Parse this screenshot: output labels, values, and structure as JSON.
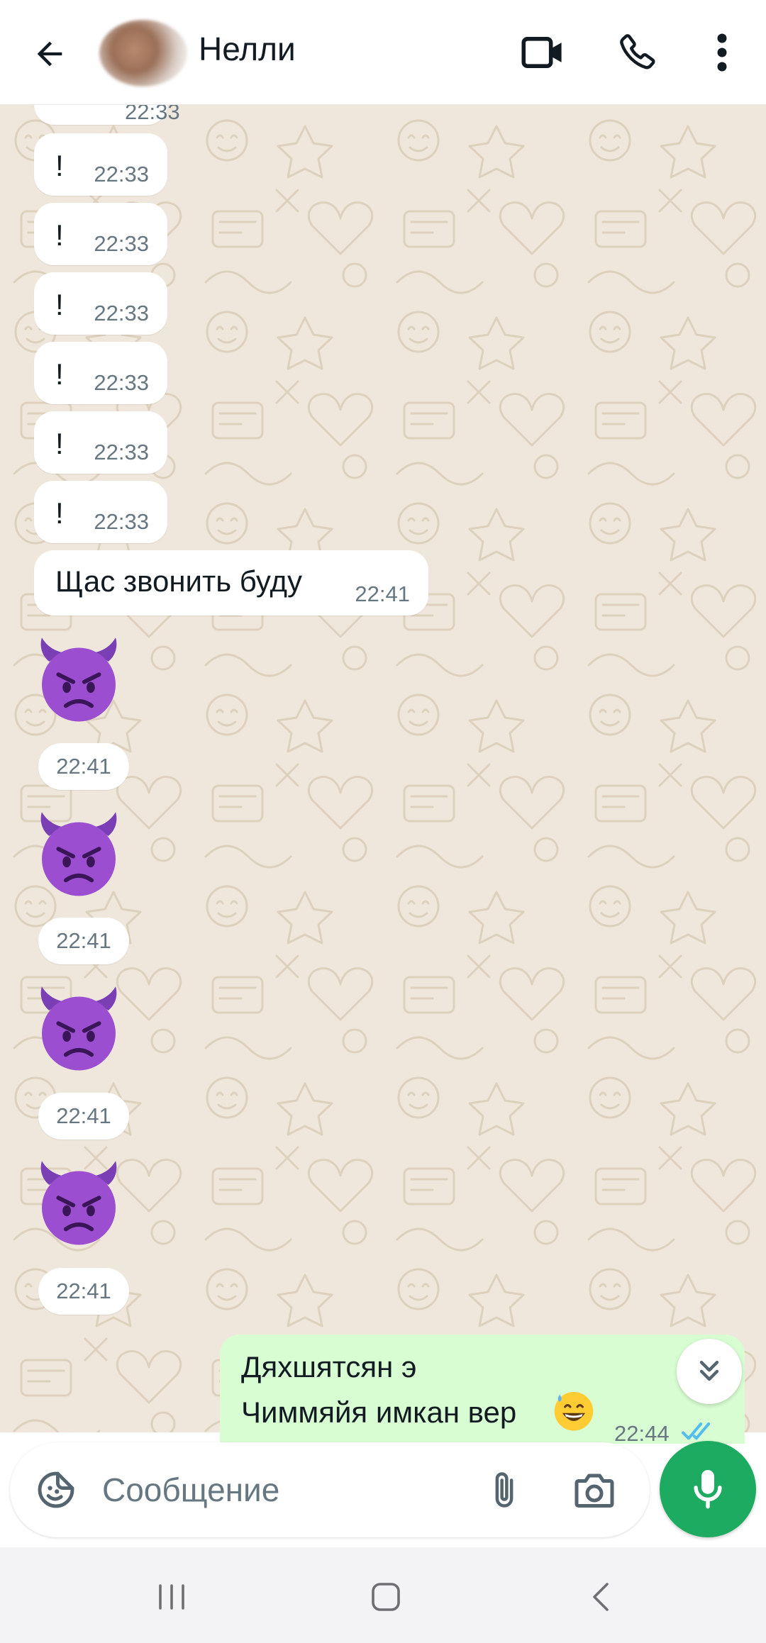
{
  "header": {
    "contact_name": "Нелли",
    "icons": [
      "arrow-left-icon",
      "video-camera-icon",
      "phone-icon",
      "more-vert-icon"
    ]
  },
  "messages": {
    "partial_top_time": "22:33",
    "exclaims": [
      {
        "text": "!",
        "time": "22:33"
      },
      {
        "text": "!",
        "time": "22:33"
      },
      {
        "text": "!",
        "time": "22:33"
      },
      {
        "text": "!",
        "time": "22:33"
      },
      {
        "text": "!",
        "time": "22:33"
      },
      {
        "text": "!",
        "time": "22:33"
      }
    ],
    "text_message": {
      "text": "Щас звонить буду",
      "time": "22:41"
    },
    "emoji_messages": [
      {
        "emoji": "smiling-face-with-horns",
        "time": "22:41"
      },
      {
        "emoji": "smiling-face-with-horns",
        "time": "22:41"
      },
      {
        "emoji": "smiling-face-with-horns",
        "time": "22:41"
      },
      {
        "emoji": "smiling-face-with-horns",
        "time": "22:41"
      }
    ],
    "outgoing": {
      "line1": "Дяхшятсян э",
      "line2": "Чиммяйя имкан вер",
      "emoji": "grinning-face-with-sweat",
      "time": "22:44",
      "status": "read"
    }
  },
  "composer": {
    "placeholder": "Сообщение",
    "value": ""
  },
  "colors": {
    "incoming_bubble": "#ffffff",
    "outgoing_bubble": "#d9fdd3",
    "wallpaper": "#efe7dc",
    "mic_button": "#1daa61",
    "read_ticks": "#53bdeb"
  }
}
